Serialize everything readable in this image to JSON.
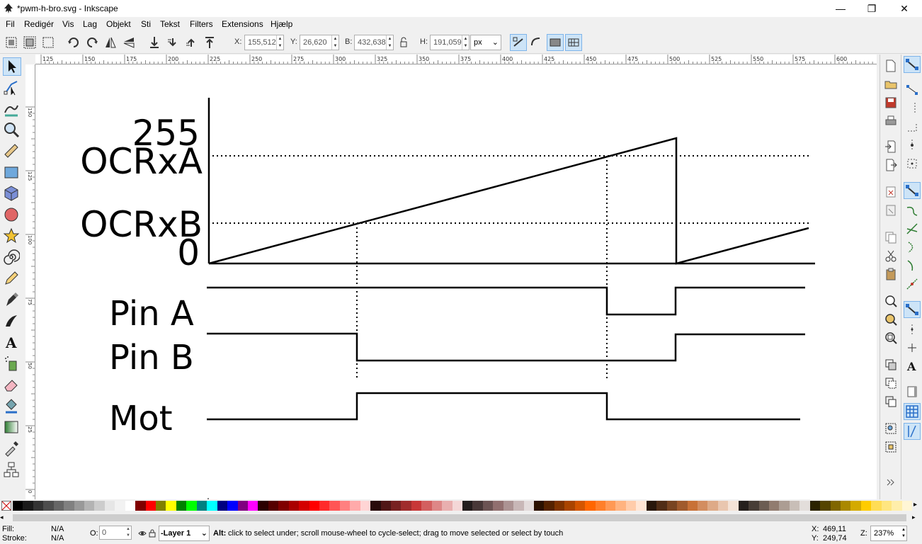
{
  "window": {
    "title": "*pwm-h-bro.svg - Inkscape",
    "controls": {
      "minimize": "—",
      "maximize": "❐",
      "close": "✕"
    }
  },
  "menubar": {
    "items": [
      {
        "label": "Fil"
      },
      {
        "label": "Redigér"
      },
      {
        "label": "Vis"
      },
      {
        "label": "Lag"
      },
      {
        "label": "Objekt"
      },
      {
        "label": "Sti"
      },
      {
        "label": "Tekst"
      },
      {
        "label": "Filters"
      },
      {
        "label": "Extensions"
      },
      {
        "label": "Hjælp"
      }
    ]
  },
  "toolbar": {
    "x_label": "X:",
    "x_value": "155,512",
    "y_label": "Y:",
    "y_value": "26,620",
    "w_label": "B:",
    "w_value": "432,638",
    "h_label": "H:",
    "h_value": "191,059",
    "unit": "px"
  },
  "rulers": {
    "horizontal_ticks": [
      "125",
      "150",
      "175",
      "200",
      "225",
      "250",
      "275",
      "300",
      "325",
      "350",
      "375",
      "400",
      "425",
      "450",
      "475",
      "500",
      "525",
      "550",
      "575",
      "600"
    ],
    "vertical_ticks": [
      "150",
      "125",
      "100",
      "75",
      "50",
      "25",
      "0"
    ]
  },
  "drawing": {
    "labels": {
      "max": "255",
      "ocra": "OCRxA",
      "ocrb": "OCRxB",
      "zero": "0",
      "pin_a": "Pin A",
      "pin_b": "Pin B",
      "mot": "Mot"
    }
  },
  "palette": {
    "colors": [
      "#000000",
      "#1a1a1a",
      "#333333",
      "#4d4d4d",
      "#666666",
      "#808080",
      "#999999",
      "#b3b3b3",
      "#cccccc",
      "#e6e6e6",
      "#f2f2f2",
      "#ffffff",
      "#800000",
      "#ff0000",
      "#808000",
      "#ffff00",
      "#008000",
      "#00ff00",
      "#008080",
      "#00ffff",
      "#000080",
      "#0000ff",
      "#800080",
      "#ff00ff",
      "#2b0000",
      "#550000",
      "#800000",
      "#aa0000",
      "#d40000",
      "#ff0000",
      "#ff2a2a",
      "#ff5555",
      "#ff8080",
      "#ffaaaa",
      "#ffd5d5",
      "#280b0b",
      "#501616",
      "#782121",
      "#a02c2c",
      "#c83737",
      "#d35f5f",
      "#de8787",
      "#e9afaf",
      "#f4d7d7",
      "#241c1c",
      "#483737",
      "#6c5353",
      "#916f6f",
      "#ac9393",
      "#c8b7b7",
      "#e3dbdb",
      "#2b1100",
      "#552200",
      "#803300",
      "#aa4400",
      "#d45500",
      "#ff6600",
      "#ff7f2a",
      "#ff9955",
      "#ffb380",
      "#ffccaa",
      "#ffe6d5",
      "#28170b",
      "#502d16",
      "#784421",
      "#a05a2c",
      "#c87137",
      "#d38d5f",
      "#deaa87",
      "#e9c6af",
      "#f4e3d7",
      "#241f1c",
      "#483e37",
      "#6c5d53",
      "#917c6f",
      "#ac9d93",
      "#c8beb7",
      "#e3dedb",
      "#2b2200",
      "#554400",
      "#806600",
      "#aa8800",
      "#d4aa00",
      "#ffcc00",
      "#ffdd55",
      "#ffe680",
      "#ffeeaa",
      "#fff6d5"
    ]
  },
  "status": {
    "fill_label": "Fill:",
    "fill_value": "N/A",
    "stroke_label": "Stroke:",
    "stroke_value": "N/A",
    "opacity_label": "O:",
    "opacity_value": "0",
    "layer": "-Layer 1",
    "message_key": "Alt:",
    "message": "click to select under; scroll mouse-wheel to cycle-select; drag to move selected or select by touch",
    "x_label": "X:",
    "x_value": "469,11",
    "y_label": "Y:",
    "y_value": "249,74",
    "zoom_label": "Z:",
    "zoom_value": "237%"
  }
}
